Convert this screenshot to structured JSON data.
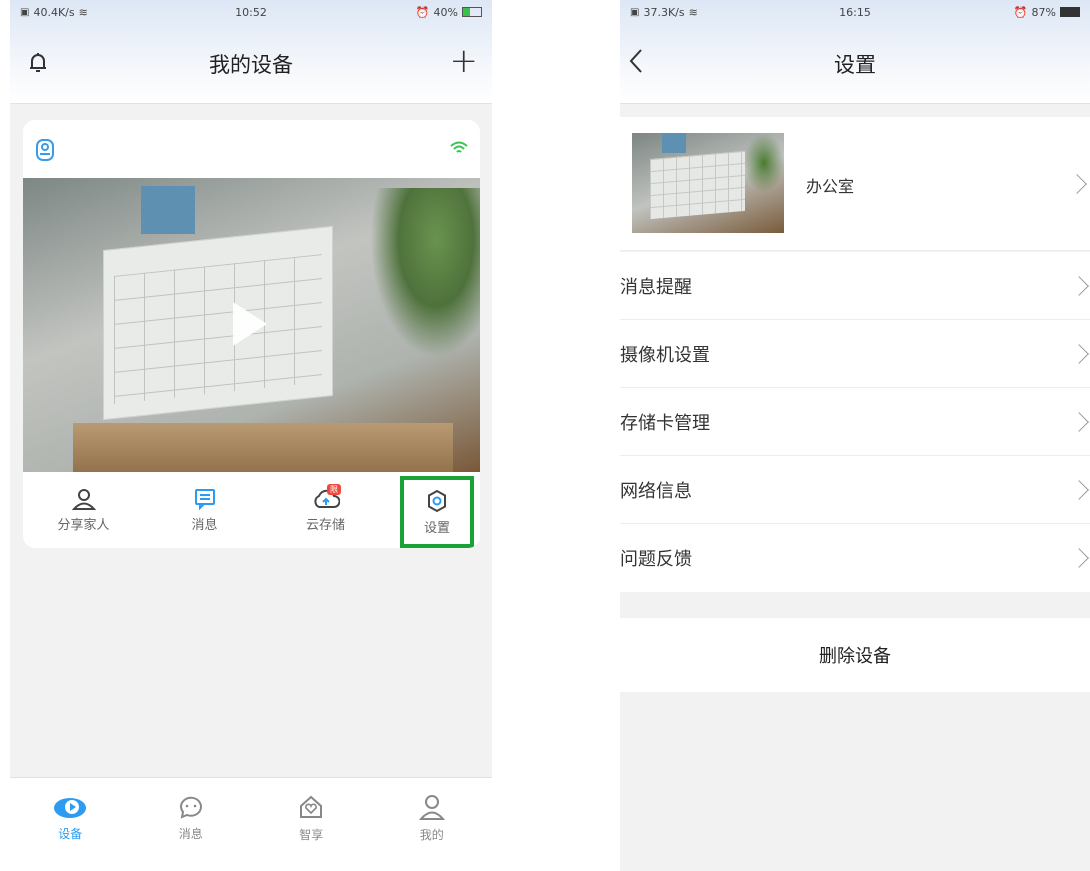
{
  "left": {
    "status": {
      "speed": "40.4K/s",
      "time": "10:52",
      "battery": "40%"
    },
    "title": "我的设备",
    "add_label": "+",
    "actions": [
      "分享家人",
      "消息",
      "云存储",
      "设置"
    ],
    "cloud_badge": "限",
    "tabs": [
      "设备",
      "消息",
      "智享",
      "我的"
    ],
    "accent": "#2d9cf0",
    "highlight_color": "#1aa235"
  },
  "right": {
    "status": {
      "speed": "37.3K/s",
      "time": "16:15",
      "battery": "87%"
    },
    "title": "设置",
    "device_name": "办公室",
    "items": [
      "消息提醒",
      "摄像机设置",
      "存储卡管理",
      "网络信息",
      "问题反馈"
    ],
    "delete_label": "删除设备"
  }
}
